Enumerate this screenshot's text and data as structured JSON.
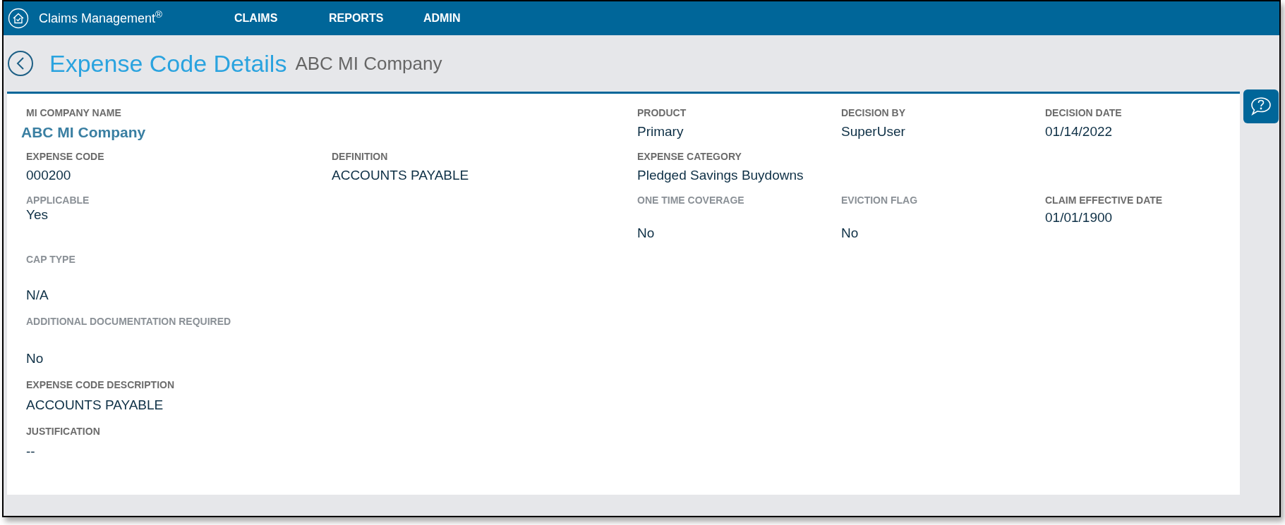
{
  "app": {
    "title": "Claims Management$^{®}$",
    "nav": [
      {
        "label": "CLAIMS"
      },
      {
        "label": "REPORTS"
      },
      {
        "label": "ADMIN"
      }
    ]
  },
  "page": {
    "title": "Expense Code Details",
    "subtitle": "ABC MI Company"
  },
  "details": {
    "mi_company_name": {
      "label": "MI COMPANY NAME",
      "value": "ABC MI Company"
    },
    "product": {
      "label": "PRODUCT",
      "value": "Primary"
    },
    "decision_by": {
      "label": "DECISION BY",
      "value": "SuperUser"
    },
    "decision_date": {
      "label": "DECISION DATE",
      "value": "01/14/2022"
    },
    "expense_code": {
      "label": "EXPENSE CODE",
      "value": "000200"
    },
    "definition": {
      "label": "DEFINITION",
      "value": "ACCOUNTS PAYABLE"
    },
    "expense_category": {
      "label": "EXPENSE CATEGORY",
      "value": "Pledged Savings Buydowns"
    },
    "applicable": {
      "label": "APPLICABLE",
      "value": "Yes"
    },
    "one_time_coverage": {
      "label": "ONE TIME COVERAGE",
      "value": "No"
    },
    "eviction_flag": {
      "label": "EVICTION FLAG",
      "value": "No"
    },
    "claim_effective_date": {
      "label": "CLAIM EFFECTIVE DATE",
      "value": "01/01/1900"
    },
    "cap_type": {
      "label": "CAP TYPE",
      "value": "N/A"
    },
    "additional_documentation_required": {
      "label": "ADDITIONAL DOCUMENTATION REQUIRED",
      "value": "No"
    },
    "expense_code_description": {
      "label": "EXPENSE CODE DESCRIPTION",
      "value": "ACCOUNTS PAYABLE"
    },
    "justification": {
      "label": "JUSTIFICATION",
      "value": "--"
    }
  }
}
